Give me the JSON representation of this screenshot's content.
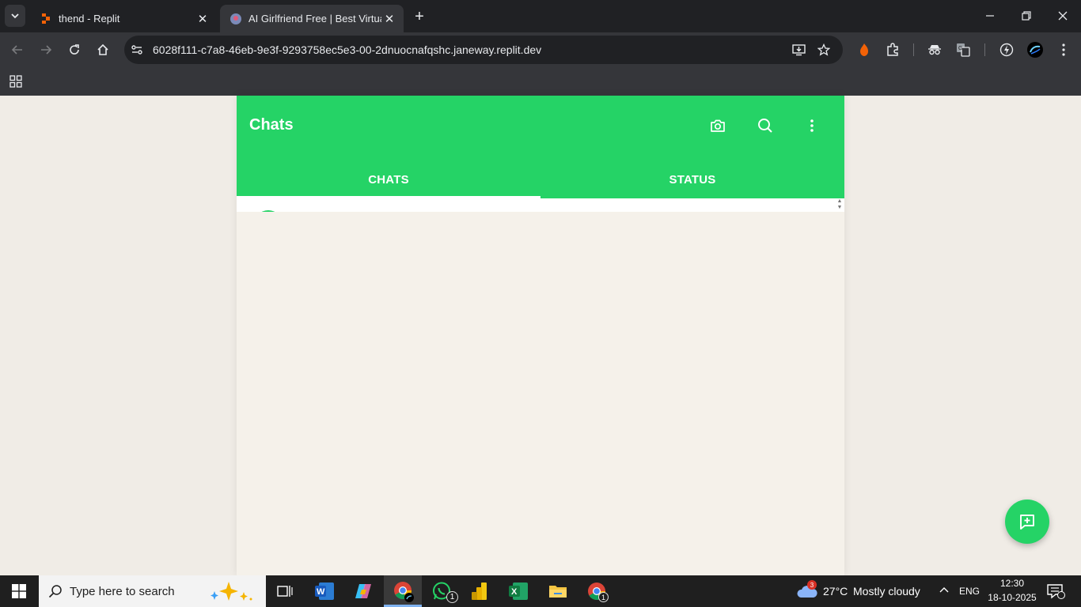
{
  "browser": {
    "tabs": [
      {
        "title": "thend - Replit",
        "active": false
      },
      {
        "title": "AI Girlfriend Free | Best Virtual C",
        "active": true
      }
    ],
    "url": "6028f111-c7a8-46eb-9e3f-9293758ec5e3-00-2dnuocnafqshc.janeway.replit.dev"
  },
  "app": {
    "header_title": "Chats",
    "tabs": [
      {
        "label": "CHATS",
        "active": true
      },
      {
        "label": "STATUS",
        "active": false
      }
    ],
    "accent_color": "#25d366"
  },
  "taskbar": {
    "search_placeholder": "Type here to search",
    "weather": {
      "temperature": "27°C",
      "condition": "Mostly cloudy",
      "alerts": "3"
    },
    "language": "ENG",
    "time": "12:30",
    "date": "18-10-2025",
    "whatsapp_badge": "1",
    "chrome_badge": "1"
  }
}
